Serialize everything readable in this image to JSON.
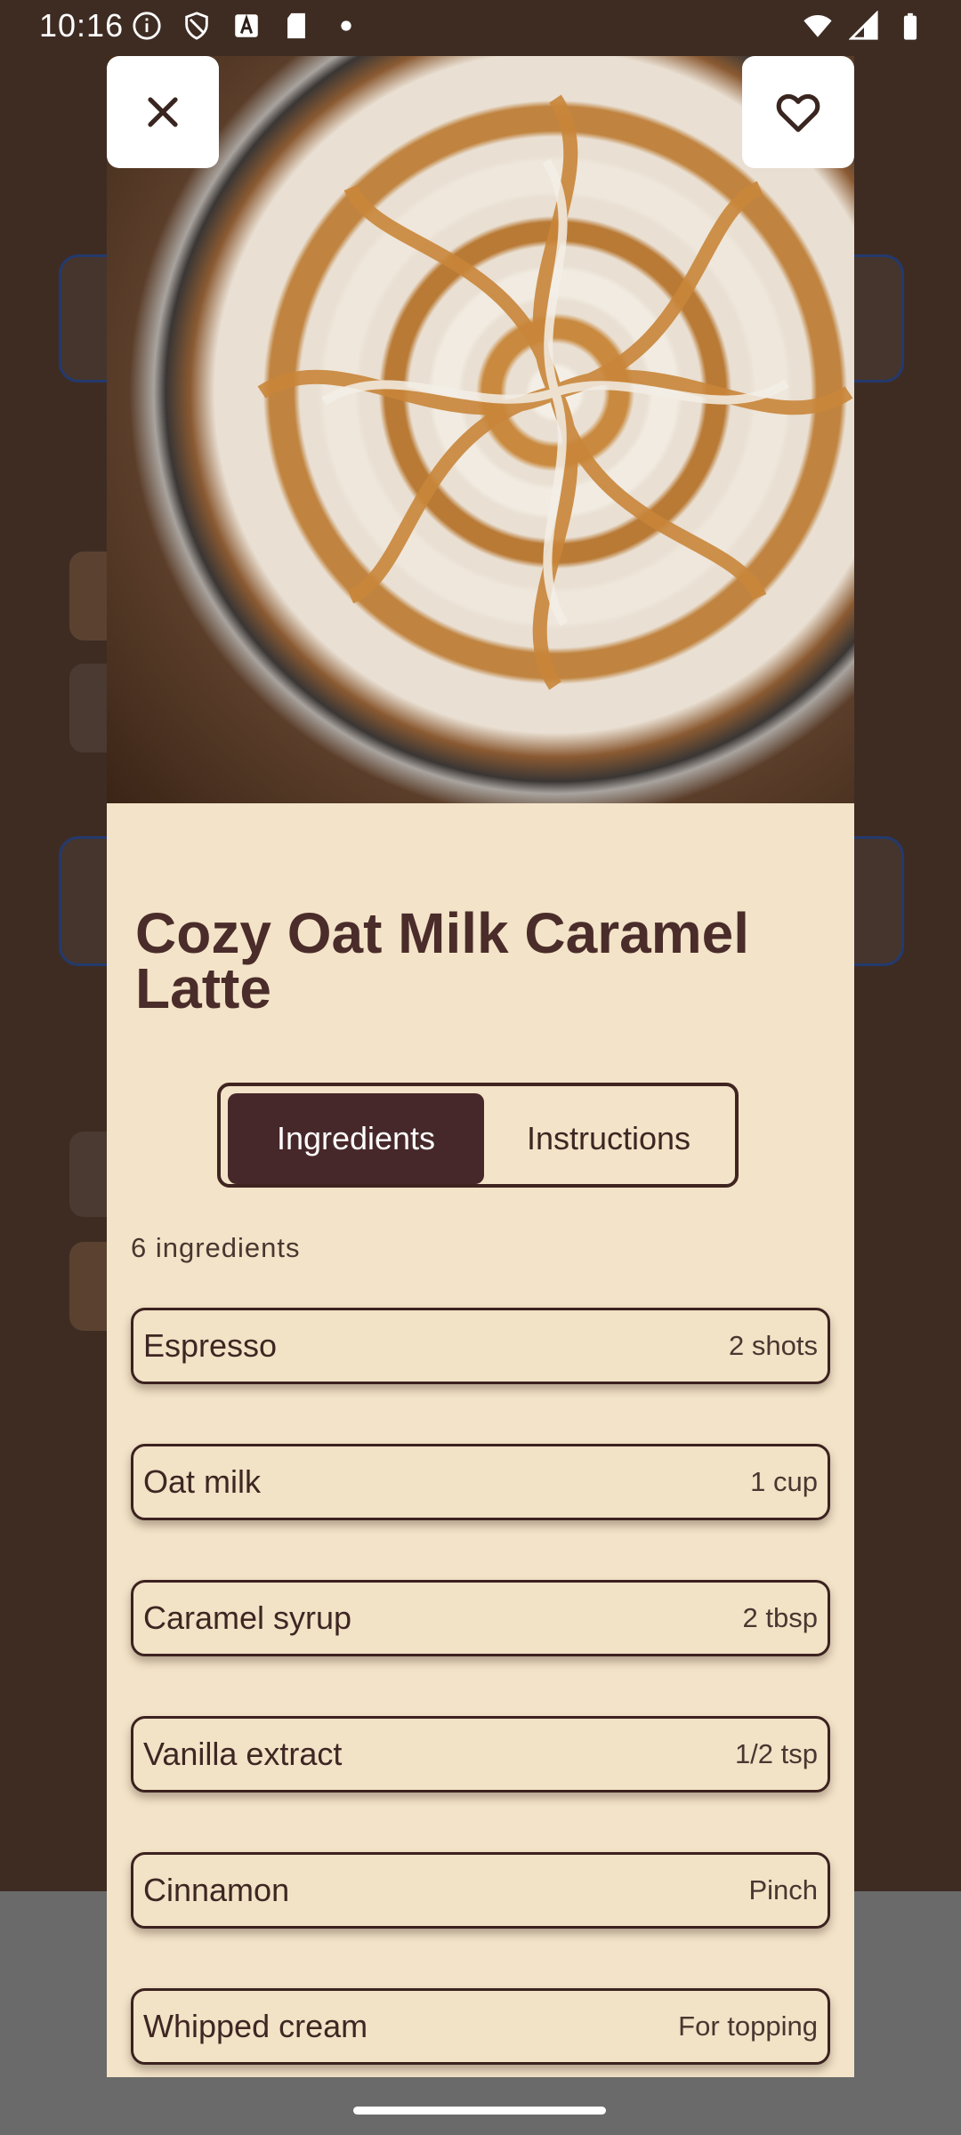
{
  "status_bar": {
    "time": "10:16",
    "left_icons": [
      "info-icon",
      "shield-icon",
      "font-icon",
      "sd-card-icon",
      "dot-icon"
    ],
    "right_icons": [
      "wifi-icon",
      "signal-icon",
      "battery-icon"
    ]
  },
  "dialog": {
    "close_icon": "close-icon",
    "favorite_icon": "heart-outline-icon",
    "title": "Cozy Oat Milk Caramel Latte",
    "tabs": [
      {
        "label": "Ingredients",
        "selected": true
      },
      {
        "label": "Instructions",
        "selected": false
      }
    ],
    "ingredient_count": "6 ingredients",
    "ingredients": [
      {
        "name": "Espresso",
        "amount": "2 shots"
      },
      {
        "name": "Oat milk",
        "amount": "1 cup"
      },
      {
        "name": "Caramel syrup",
        "amount": "2 tbsp"
      },
      {
        "name": "Vanilla extract",
        "amount": "1/2 tsp"
      },
      {
        "name": "Cinnamon",
        "amount": "Pinch"
      },
      {
        "name": "Whipped cream",
        "amount": "For topping"
      }
    ]
  },
  "colors": {
    "dialog_bg": "#f3e3c8",
    "accent_dark": "#47282a",
    "title": "#4a2c2a",
    "scrim": "#3e2c23"
  }
}
